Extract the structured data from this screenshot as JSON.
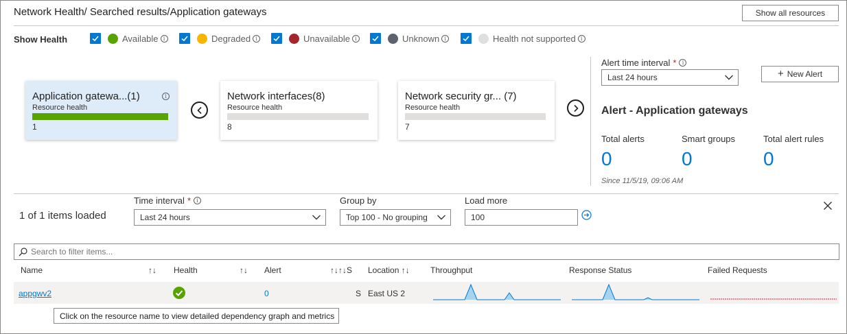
{
  "header": {
    "title": "Network Health/ Searched results/Application gateways",
    "show_all_label": "Show all resources"
  },
  "health_filter": {
    "label": "Show Health",
    "items": [
      {
        "label": "Available",
        "color": "#57a300"
      },
      {
        "label": "Degraded",
        "color": "#f8b500"
      },
      {
        "label": "Unavailable",
        "color": "#a4262c"
      },
      {
        "label": "Unknown",
        "color": "#5c636e"
      },
      {
        "label": "Health not supported",
        "color": "#e1dfdd"
      }
    ],
    "checkbox_color": "#0078d4"
  },
  "cards": [
    {
      "title": "Application gatewa...(1)",
      "subtitle": "Resource health",
      "count": "1",
      "health_fraction": 1.0,
      "selected": true
    },
    {
      "title": "Network interfaces(8)",
      "subtitle": "Resource health",
      "count": "8",
      "health_fraction": 0.0,
      "selected": false
    },
    {
      "title": "Network security gr... (7)",
      "subtitle": "Resource health",
      "count": "7",
      "health_fraction": 0.0,
      "selected": false
    }
  ],
  "alerts": {
    "interval_label": "Alert time interval",
    "required_mark": "*",
    "interval_value": "Last 24 hours",
    "new_alert_label": "New Alert",
    "heading": "Alert - Application gateways",
    "stats": [
      {
        "label": "Total alerts",
        "value": "0"
      },
      {
        "label": "Smart groups",
        "value": "0"
      },
      {
        "label": "Total alert rules",
        "value": "0"
      }
    ],
    "since": "Since 11/5/19, 09:06 AM"
  },
  "filters": {
    "items_loaded": "1 of 1 items loaded",
    "time_interval_label": "Time interval",
    "required_mark": "*",
    "time_interval_value": "Last 24 hours",
    "group_by_label": "Group by",
    "group_by_value": "Top 100 - No grouping",
    "load_more_label": "Load more",
    "load_more_value": "100"
  },
  "search": {
    "placeholder": "Search to filter items..."
  },
  "table": {
    "columns": {
      "name": "Name",
      "health": "Health",
      "alert": "Alert",
      "status_sort": "↑↓↑↓S",
      "location": "Location ↑↓",
      "throughput": "Throughput",
      "response_status": "Response Status",
      "failed_requests": "Failed Requests"
    },
    "sort_icon": "↑↓",
    "rows": [
      {
        "name": "appgwv2",
        "health": "available",
        "alert": "0",
        "status": "S",
        "location": "East US 2"
      }
    ]
  },
  "tooltip": {
    "text": "Click on the resource name to view detailed dependency graph and metrics"
  }
}
